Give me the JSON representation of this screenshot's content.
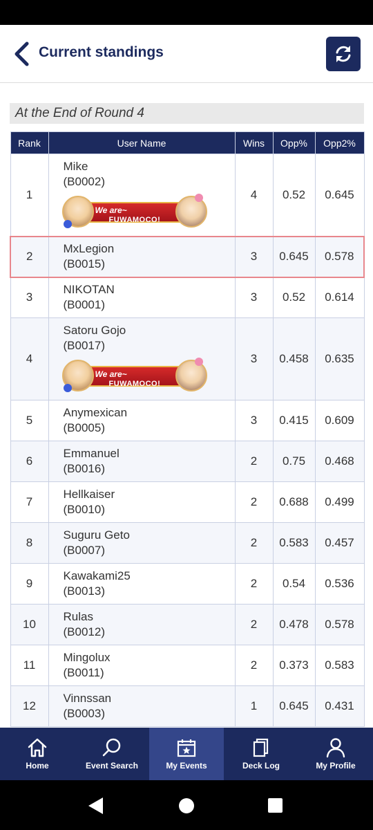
{
  "header": {
    "title": "Current standings",
    "back_icon": "chevron-left-icon",
    "refresh_icon": "refresh-icon"
  },
  "round_label": "At the End of Round 4",
  "table": {
    "columns": [
      "Rank",
      "User Name",
      "Wins",
      "Opp%",
      "Opp2%"
    ],
    "rows": [
      {
        "rank": "1",
        "name": "Mike",
        "id": "(B0002)",
        "wins": "4",
        "opp": "0.52",
        "opp2": "0.645",
        "banner": true
      },
      {
        "rank": "2",
        "name": "MxLegion",
        "id": "(B0015)",
        "wins": "3",
        "opp": "0.645",
        "opp2": "0.578",
        "highlighted": true
      },
      {
        "rank": "3",
        "name": "NIKOTAN",
        "id": "(B0001)",
        "wins": "3",
        "opp": "0.52",
        "opp2": "0.614"
      },
      {
        "rank": "4",
        "name": "Satoru Gojo",
        "id": "(B0017)",
        "wins": "3",
        "opp": "0.458",
        "opp2": "0.635",
        "banner": true
      },
      {
        "rank": "5",
        "name": "Anymexican",
        "id": "(B0005)",
        "wins": "3",
        "opp": "0.415",
        "opp2": "0.609"
      },
      {
        "rank": "6",
        "name": "Emmanuel",
        "id": "(B0016)",
        "wins": "2",
        "opp": "0.75",
        "opp2": "0.468"
      },
      {
        "rank": "7",
        "name": "Hellkaiser",
        "id": "(B0010)",
        "wins": "2",
        "opp": "0.688",
        "opp2": "0.499"
      },
      {
        "rank": "8",
        "name": "Suguru Geto",
        "id": "(B0007)",
        "wins": "2",
        "opp": "0.583",
        "opp2": "0.457"
      },
      {
        "rank": "9",
        "name": "Kawakami25",
        "id": "(B0013)",
        "wins": "2",
        "opp": "0.54",
        "opp2": "0.536"
      },
      {
        "rank": "10",
        "name": "Rulas",
        "id": "(B0012)",
        "wins": "2",
        "opp": "0.478",
        "opp2": "0.578"
      },
      {
        "rank": "11",
        "name": "Mingolux",
        "id": "(B0011)",
        "wins": "2",
        "opp": "0.373",
        "opp2": "0.583"
      },
      {
        "rank": "12",
        "name": "Vinnssan",
        "id": "(B0003)",
        "wins": "1",
        "opp": "0.645",
        "opp2": "0.431"
      }
    ]
  },
  "banner": {
    "line1": "We are~",
    "line2": "FUWAMOCO!"
  },
  "bottom_nav": [
    {
      "label": "Home",
      "icon": "home-icon"
    },
    {
      "label": "Event Search",
      "icon": "search-icon"
    },
    {
      "label": "My Events",
      "icon": "calendar-star-icon",
      "active": true
    },
    {
      "label": "Deck Log",
      "icon": "cards-icon"
    },
    {
      "label": "My Profile",
      "icon": "person-icon"
    }
  ],
  "colors": {
    "primary": "#1c2a5e",
    "active_nav": "#34468a",
    "highlight_border": "#e8868c"
  }
}
